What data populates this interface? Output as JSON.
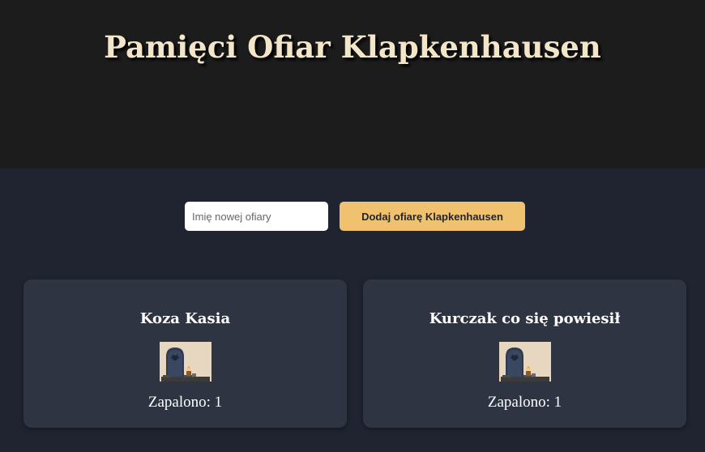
{
  "header": {
    "title": "Pamięci Ofiar Klapkenhausen"
  },
  "form": {
    "input_placeholder": "Imię nowej ofiary",
    "input_value": "",
    "add_button_label": "Dodaj ofiarę Klapkenhausen"
  },
  "cards": [
    {
      "name": "Koza Kasia",
      "count_label": "Zapalono: 1",
      "image_icon": "gravestone-candle-icon"
    },
    {
      "name": "Kurczak co się powiesił",
      "count_label": "Zapalono: 1",
      "image_icon": "gravestone-candle-icon"
    }
  ],
  "colors": {
    "header_bg": "#1c1c1c",
    "main_bg": "#1f2430",
    "card_bg": "#2e3441",
    "accent_button": "#f0c270",
    "title_text": "#f3e6c8"
  }
}
